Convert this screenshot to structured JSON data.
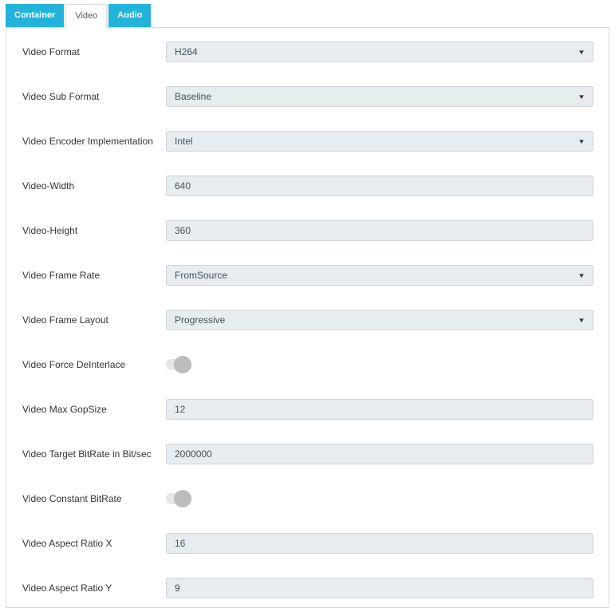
{
  "theme": {
    "accent_color": "#23b2d9",
    "panel_border_color": "#d8dce1",
    "field_bg_color": "#e9ecef",
    "field_border_color": "#ced4da",
    "toggle_knob_color": "#bcbcbc"
  },
  "tabs": [
    {
      "label": "Container",
      "active": false
    },
    {
      "label": "Video",
      "active": true
    },
    {
      "label": "Audio",
      "active": false
    }
  ],
  "dropdown_arrow_icon": "▼",
  "fields": [
    {
      "label": "Video Format",
      "type": "select",
      "value": "H264"
    },
    {
      "label": "Video Sub Format",
      "type": "select",
      "value": "Baseline"
    },
    {
      "label": "Video Encoder Implementation",
      "type": "select",
      "value": "Intel"
    },
    {
      "label": "Video-Width",
      "type": "text",
      "value": "640"
    },
    {
      "label": "Video-Height",
      "type": "text",
      "value": "360"
    },
    {
      "label": "Video Frame Rate",
      "type": "select",
      "value": "FromSource"
    },
    {
      "label": "Video Frame Layout",
      "type": "select",
      "value": "Progressive"
    },
    {
      "label": "Video Force DeInterlace",
      "type": "toggle",
      "state": "on"
    },
    {
      "label": "Video Max GopSize",
      "type": "text",
      "value": "12"
    },
    {
      "label": "Video Target BitRate in Bit/sec",
      "type": "text",
      "value": "2000000"
    },
    {
      "label": "Video Constant BitRate",
      "type": "toggle",
      "state": "on"
    },
    {
      "label": "Video Aspect Ratio X",
      "type": "text",
      "value": "16"
    },
    {
      "label": "Video Aspect Ratio Y",
      "type": "text",
      "value": "9"
    }
  ]
}
